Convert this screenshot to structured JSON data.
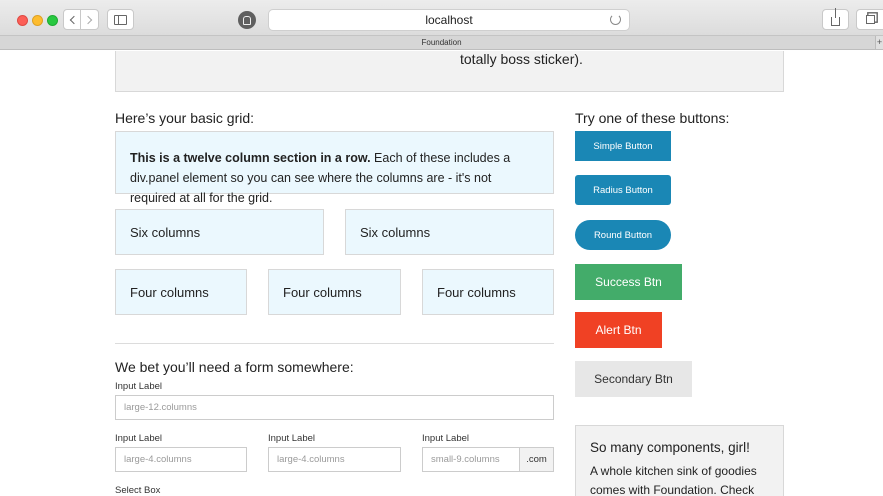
{
  "browser": {
    "address": "localhost",
    "tab_title": "Foundation",
    "new_tab_label": "+"
  },
  "top_panel": {
    "text": "totally boss sticker)."
  },
  "grid": {
    "heading": "Here’s your basic grid:",
    "twelve_bold": "This is a twelve column section in a row.",
    "twelve_text": " Each of these includes a div.panel element so you can see where the columns are - it's not required at all for the grid.",
    "six_a": "Six columns",
    "six_b": "Six columns",
    "four_a": "Four columns",
    "four_b": "Four columns",
    "four_c": "Four columns"
  },
  "form": {
    "heading": "We bet you’ll need a form somewhere:",
    "label_1": "Input Label",
    "placeholder_1": "large-12.columns",
    "label_2": "Input Label",
    "placeholder_2": "large-4.columns",
    "label_3": "Input Label",
    "placeholder_3": "large-4.columns",
    "label_4": "Input Label",
    "placeholder_4": "small-9.columns",
    "postfix": ".com",
    "select_label": "Select Box"
  },
  "buttons": {
    "heading": "Try one of these buttons:",
    "simple": "Simple Button",
    "radius": "Radius Button",
    "round": "Round Button",
    "success": "Success Btn",
    "alert": "Alert Btn",
    "secondary": "Secondary Btn"
  },
  "components": {
    "title": "So many components, girl!",
    "body": "A whole kitchen sink of goodies comes with Foundation. Check out"
  },
  "colors": {
    "primary": "#1a87b5",
    "success": "#43ac6a",
    "alert": "#f04124",
    "secondary": "#e7e7e7",
    "panel_callout": "#ebf8fe"
  }
}
